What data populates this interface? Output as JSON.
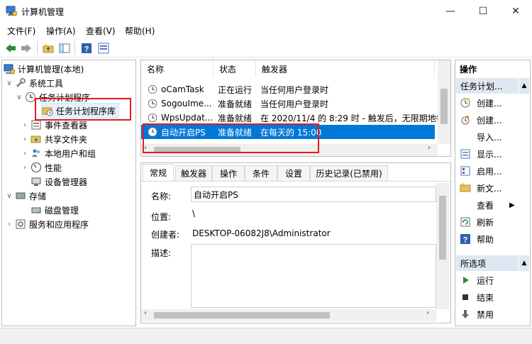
{
  "window": {
    "title": "计算机管理",
    "minimize_glyph": "—",
    "maximize_glyph": "☐",
    "close_glyph": "✕"
  },
  "menu": [
    "文件(F)",
    "操作(A)",
    "查看(V)",
    "帮助(H)"
  ],
  "toolbar": {
    "icons": [
      "back-arrow-icon",
      "forward-arrow-icon",
      "up-folder-icon",
      "show-hide-tree-icon",
      "help-icon",
      "properties-icon"
    ]
  },
  "tree": {
    "root": "计算机管理(本地)",
    "system_tools": "系统工具",
    "task_scheduler": "任务计划程序",
    "task_library": "任务计划程序库",
    "event_viewer": "事件查看器",
    "shared_folders": "共享文件夹",
    "local_users": "本地用户和组",
    "performance": "性能",
    "device_manager": "设备管理器",
    "storage": "存储",
    "disk_management": "磁盘管理",
    "services_apps": "服务和应用程序"
  },
  "list": {
    "columns": [
      "名称",
      "状态",
      "触发器"
    ],
    "rows": [
      {
        "name": "oCamTask",
        "status": "正在运行",
        "trigger": "当任何用户登录时"
      },
      {
        "name": "SogouIme...",
        "status": "准备就绪",
        "trigger": "当任何用户登录时"
      },
      {
        "name": "WpsUpdat...",
        "status": "准备就绪",
        "trigger": "在 2020/11/4 的 8:29 时 - 触发后，无限期地每"
      },
      {
        "name": "自动开启PS",
        "status": "准备就绪",
        "trigger": "在每天的 15:00"
      }
    ],
    "selected_index": 3
  },
  "detail": {
    "tabs": [
      "常规",
      "触发器",
      "操作",
      "条件",
      "设置",
      "历史记录(已禁用)"
    ],
    "active_tab": "常规",
    "name_label": "名称:",
    "name_value": "自动开启PS",
    "location_label": "位置:",
    "location_value": "\\",
    "author_label": "创建者:",
    "author_value": "DESKTOP-06082J8\\Administrator",
    "description_label": "描述:"
  },
  "actions": {
    "header": "操作",
    "section1": "任务计划...",
    "items1": [
      "创建...",
      "创建...",
      "导入...",
      "显示...",
      "启用...",
      "新文...",
      "查看",
      "刷新",
      "帮助"
    ],
    "section2": "所选项",
    "items2": [
      "运行",
      "结束",
      "禁用"
    ]
  }
}
